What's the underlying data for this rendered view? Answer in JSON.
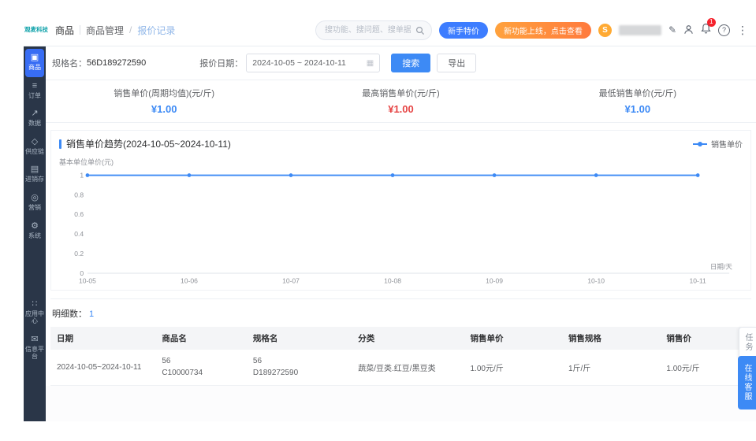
{
  "logo": {
    "text": "观麦科技"
  },
  "sidebar": {
    "items": [
      {
        "label": "商品",
        "active": true
      },
      {
        "label": "订单"
      },
      {
        "label": "数据"
      },
      {
        "label": "供应链"
      },
      {
        "label": "进销存"
      },
      {
        "label": "营销"
      },
      {
        "label": "系统"
      }
    ],
    "bottom_items": [
      {
        "label": "应用中心"
      },
      {
        "label": "信息平台"
      }
    ]
  },
  "breadcrumb": {
    "root": "商品",
    "section": "商品管理",
    "separator": "/",
    "current": "报价记录"
  },
  "topbar": {
    "search_placeholder": "搜功能、搜问题、搜单据",
    "newbie_pill": "新手特价",
    "promo_pill": "新功能上线，点击查看",
    "coin": "S",
    "bell_badge": "1",
    "help": "?"
  },
  "filters": {
    "spec_label": "规格名：",
    "spec_value": "56D189272590",
    "date_label": "报价日期：",
    "date_value": "2024-10-05 ~ 2024-10-11",
    "search_button": "搜索",
    "export_button": "导出"
  },
  "stats": [
    {
      "label": "销售单价(周期均值)(元/斤)",
      "value": "¥1.00",
      "color": "#3d8af5"
    },
    {
      "label": "最高销售单价(元/斤)",
      "value": "¥1.00",
      "color": "#e64545"
    },
    {
      "label": "最低销售单价(元/斤)",
      "value": "¥1.00",
      "color": "#3d8af5"
    }
  ],
  "chart": {
    "title": "销售单价趋势(2024-10-05~2024-10-11)",
    "legend": "销售单价",
    "y_axis_title": "基本单位单价(元)"
  },
  "chart_data": {
    "type": "line",
    "title": "销售单价趋势(2024-10-05~2024-10-11)",
    "x": [
      "10-05",
      "10-06",
      "10-07",
      "10-08",
      "10-09",
      "10-10",
      "10-11"
    ],
    "series": [
      {
        "name": "销售单价",
        "values": [
          1,
          1,
          1,
          1,
          1,
          1,
          1
        ]
      }
    ],
    "ylim": [
      0,
      1
    ],
    "y_ticks": [
      1,
      0.8,
      0.6,
      0.4,
      0.2,
      0
    ],
    "ylabel": "基本单位单价(元)",
    "xlabel": "日期/天",
    "grid": false,
    "legend_position": "top-right",
    "line_color": "#3d8af5"
  },
  "detail": {
    "label": "明细数：",
    "count": "1"
  },
  "table": {
    "headers": [
      "日期",
      "商品名",
      "规格名",
      "分类",
      "销售单价",
      "销售规格",
      "销售价"
    ],
    "rows": [
      {
        "date": "2024-10-05~2024-10-11",
        "product": [
          "56",
          "C10000734"
        ],
        "spec": [
          "56",
          "D189272590"
        ],
        "category": "蔬菜/豆类.红豆/黑豆类",
        "unit_price": "1.00元/斤",
        "sale_spec": "1斤/斤",
        "sale_price": "1.00元/斤"
      }
    ]
  },
  "floating": {
    "task": "任务",
    "service": "在线客服"
  }
}
